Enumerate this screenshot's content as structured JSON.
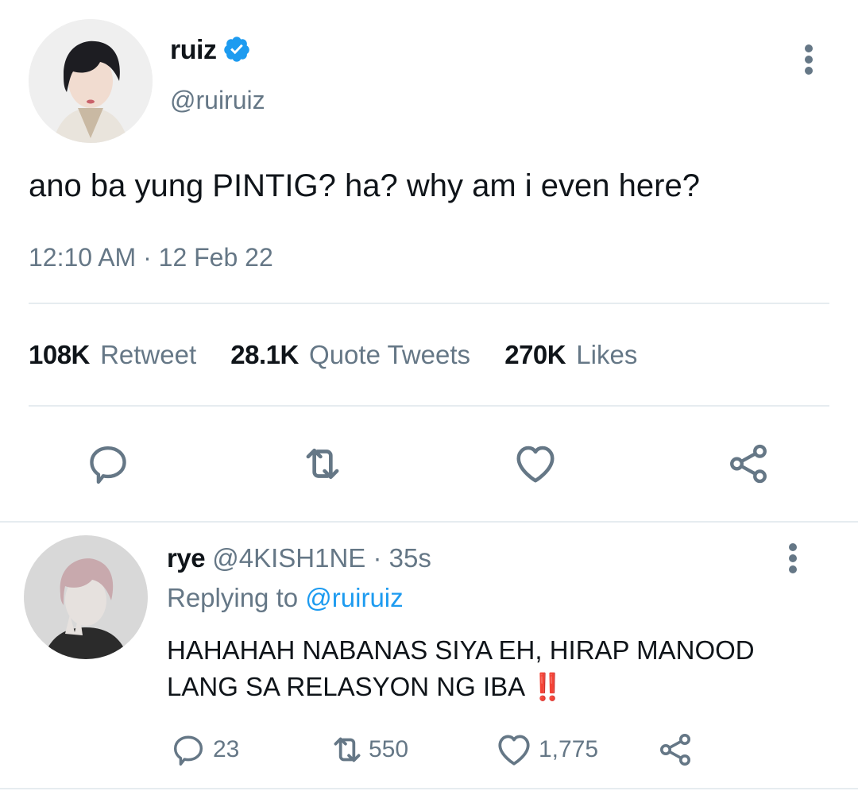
{
  "main_tweet": {
    "display_name": "ruiz",
    "handle": "@ruiruiz",
    "text": "ano ba yung PINTIG? ha? why am i even here?",
    "timestamp": "12:10 AM · 12 Feb 22",
    "stats": {
      "retweets_count": "108K",
      "retweets_label": "Retweet",
      "quotes_count": "28.1K",
      "quotes_label": "Quote Tweets",
      "likes_count": "270K",
      "likes_label": "Likes"
    },
    "verified": true,
    "icons": [
      "reply-icon",
      "retweet-icon",
      "like-icon",
      "share-icon",
      "more-icon",
      "verified-badge-icon"
    ]
  },
  "reply": {
    "display_name": "rye",
    "handle": "@4KISH1NE",
    "time": "35s",
    "replying_to_label": "Replying to",
    "replying_to_handle": "@ruiruiz",
    "text_line1": "HAHAHAH NABANAS SIYA EH, HIRAP MANOOD",
    "text_line2": "LANG SA RELASYON NG IBA",
    "emoji": "‼️",
    "reply_count": "23",
    "retweet_count": "550",
    "like_count": "1,775"
  },
  "colors": {
    "accent": "#1d9bf0",
    "text": "#0f1419",
    "muted": "#657786",
    "divider": "#e6ecf0"
  }
}
